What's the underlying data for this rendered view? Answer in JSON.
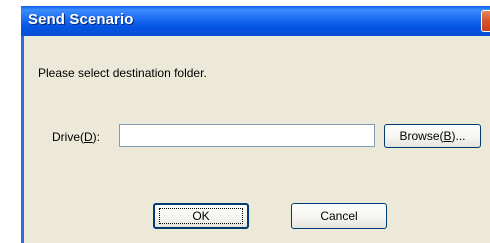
{
  "window": {
    "title": "Send Scenario"
  },
  "dialog": {
    "prompt": "Please select destination folder.",
    "drive_label_prefix": "Drive(",
    "drive_label_accel": "D",
    "drive_label_suffix": "):",
    "drive_value": "",
    "browse_prefix": "Browse(",
    "browse_accel": "B",
    "browse_suffix": ")...",
    "ok_label": "OK",
    "cancel_label": "Cancel"
  },
  "colors": {
    "titlebar": "#0a5ee6",
    "client_bg": "#ece9d8",
    "close_button": "#d6552a"
  },
  "icons": {
    "close": "close-icon"
  }
}
